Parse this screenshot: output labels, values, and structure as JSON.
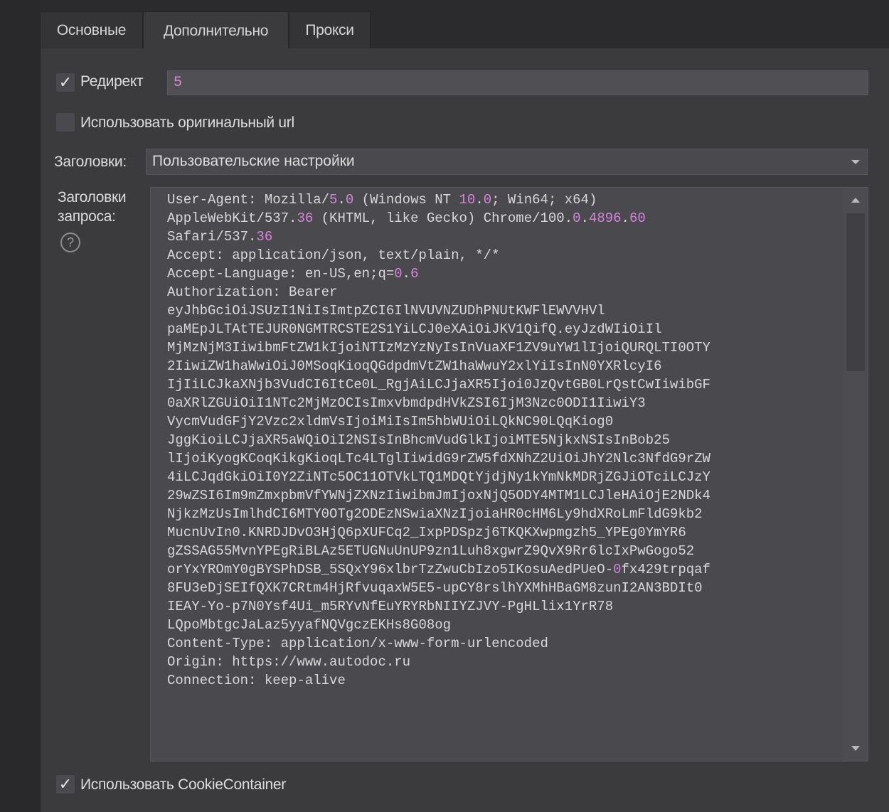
{
  "tabs": [
    {
      "label": "Основные"
    },
    {
      "label": "Дополнительно"
    },
    {
      "label": "Прокси"
    }
  ],
  "redirect": {
    "label": "Редирект",
    "checked": true,
    "value": "5"
  },
  "original_url": {
    "label": "Использовать оригинальный url",
    "checked": false
  },
  "headers": {
    "label": "Заголовки:",
    "selected": "Пользовательские настройки"
  },
  "request_headers": {
    "label_line1": "Заголовки",
    "label_line2": "запроса:",
    "help_icon": "question-circle-icon",
    "lines": [
      "User-Agent: Mozilla/5.0 (Windows NT 10.0; Win64; x64)",
      "AppleWebKit/537.36 (KHTML, like Gecko) Chrome/100.0.4896.60",
      "Safari/537.36",
      "Accept: application/json, text/plain, */*",
      "Accept-Language: en-US,en;q=0.6",
      "Authorization: Bearer",
      "eyJhbGciOiJSUzI1NiIsImtpZCI6IlNVUVNZUDhPNUtKWFlEWVVHVl",
      "paMEpJLTAtTEJUR0NGMTRCSTE2S1YiLCJ0eXAiOiJKV1QifQ.eyJzdWIiOiIl",
      "MjMzNjM3IiwibmFtZW1kIjoiNTIzMzYzNyIsInVuaXF1ZV9uYW1lIjoiQURQLTI0OTY",
      "2IiwiZW1haWwiOiJ0MSoqKioqQGdpdmVtZW1haWwuY2xlYiIsInN0YXRlcyI6",
      "IjIiLCJkaXNjb3VudCI6ItCe0L_RgjAiLCJjaXR5Ijoi0JzQvtGB0LrQstCwIiwibGF",
      "0aXRlZGUiOiI1NTc2MjMzOCIsImxvbmdpdHVkZSI6IjM3Nzc0ODI1IiwiY3",
      "VycmVudGFjY2Vzc2xldmVsIjoiMiIsIm5hbWUiOiLQkNC90LQqKiog0",
      "JggKioiLCJjaXR5aWQiOiI2NSIsInBhcmVudGlkIjoiMTE5NjkxNSIsInBob25",
      "lIjoiKyogKCoqKikgKioqLTc4LTglIiwidG9rZW5fdXNhZ2UiOiJhY2Nlc3NfdG9rZW",
      "4iLCJqdGkiOiI0Y2ZiNTc5OC11OTVkLTQ1MDQtYjdjNy1kYmNkMDRjZGJiOTciLCJzY",
      "29wZSI6Im9mZmxpbmVfYWNjZXNzIiwibmJmIjoxNjQ5ODY4MTM1LCJleHAiOjE2NDk4",
      "NjkzMzUsImlhdCI6MTY0OTg2ODEzNSwiaXNzIjoiaHR0cHM6Ly9hdXRoLmFldG9kb2",
      "MucnUvIn0.KNRDJDvO3HjQ6pXUFCq2_IxpPDSpzj6TKQKXwpmgzh5_YPEg0YmYR6",
      "gZSSAG55MvnYPEgRiBLAz5ETUGNuUnUP9zn1Luh8xgwrZ9QvX9Rr6lcIxPwGogo52",
      "orYxYROmY0gBYSPhDSB_5SQxY96xlbrTzZwuCbIzo5IKosuAedPUeO-0fx429trpqaf",
      "8FU3eDjSEIfQXK7CRtm4HjRfvuqaxW5E5-upCY8rslhYXMhHBaGM8zunI2AN3BDIt0",
      "IEAY-Yo-p7N0Ysf4Ui_m5RYvNfEuYRYRbNIIYZJVY-PgHLlix1YrR78",
      "LQpoMbtgcJaLaz5yyafNQVgczEKHs8G08og",
      "Content-Type: application/x-www-form-urlencoded",
      "Origin: https://www.autodoc.ru",
      "Connection: keep-alive"
    ]
  },
  "cookie_container": {
    "label": "Использовать CookieContainer",
    "checked": true
  },
  "colors": {
    "background": "#3b3b3e",
    "number_highlight": "#d286d9",
    "text": "#d8d8d8"
  }
}
